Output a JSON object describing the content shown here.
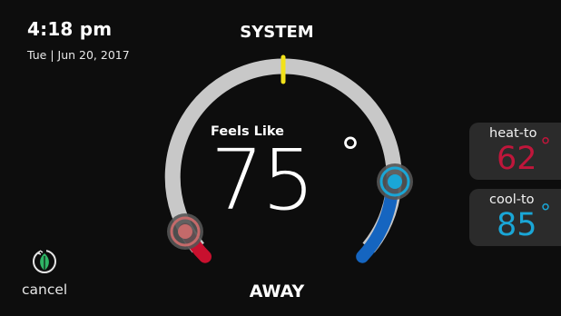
{
  "status": {
    "time": "4:18 pm",
    "date": "Tue | Jun 20, 2017"
  },
  "mode": {
    "system_label": "SYSTEM",
    "away_label": "AWAY"
  },
  "dial": {
    "feels_like_label": "Feels Like",
    "current_temp": "75",
    "degree_symbol": "°"
  },
  "setpoints": {
    "heat_label": "heat-to",
    "heat_value": "62",
    "cool_label": "cool-to",
    "cool_value": "85",
    "degree_symbol": "°"
  },
  "cancel": {
    "label": "cancel",
    "icon": "leaf-icon"
  },
  "colors": {
    "heat": "#c0163b",
    "cool": "#1aa6d6",
    "track": "#c8c8c8",
    "marker": "#f2e21a",
    "eco": "#2fb565"
  }
}
